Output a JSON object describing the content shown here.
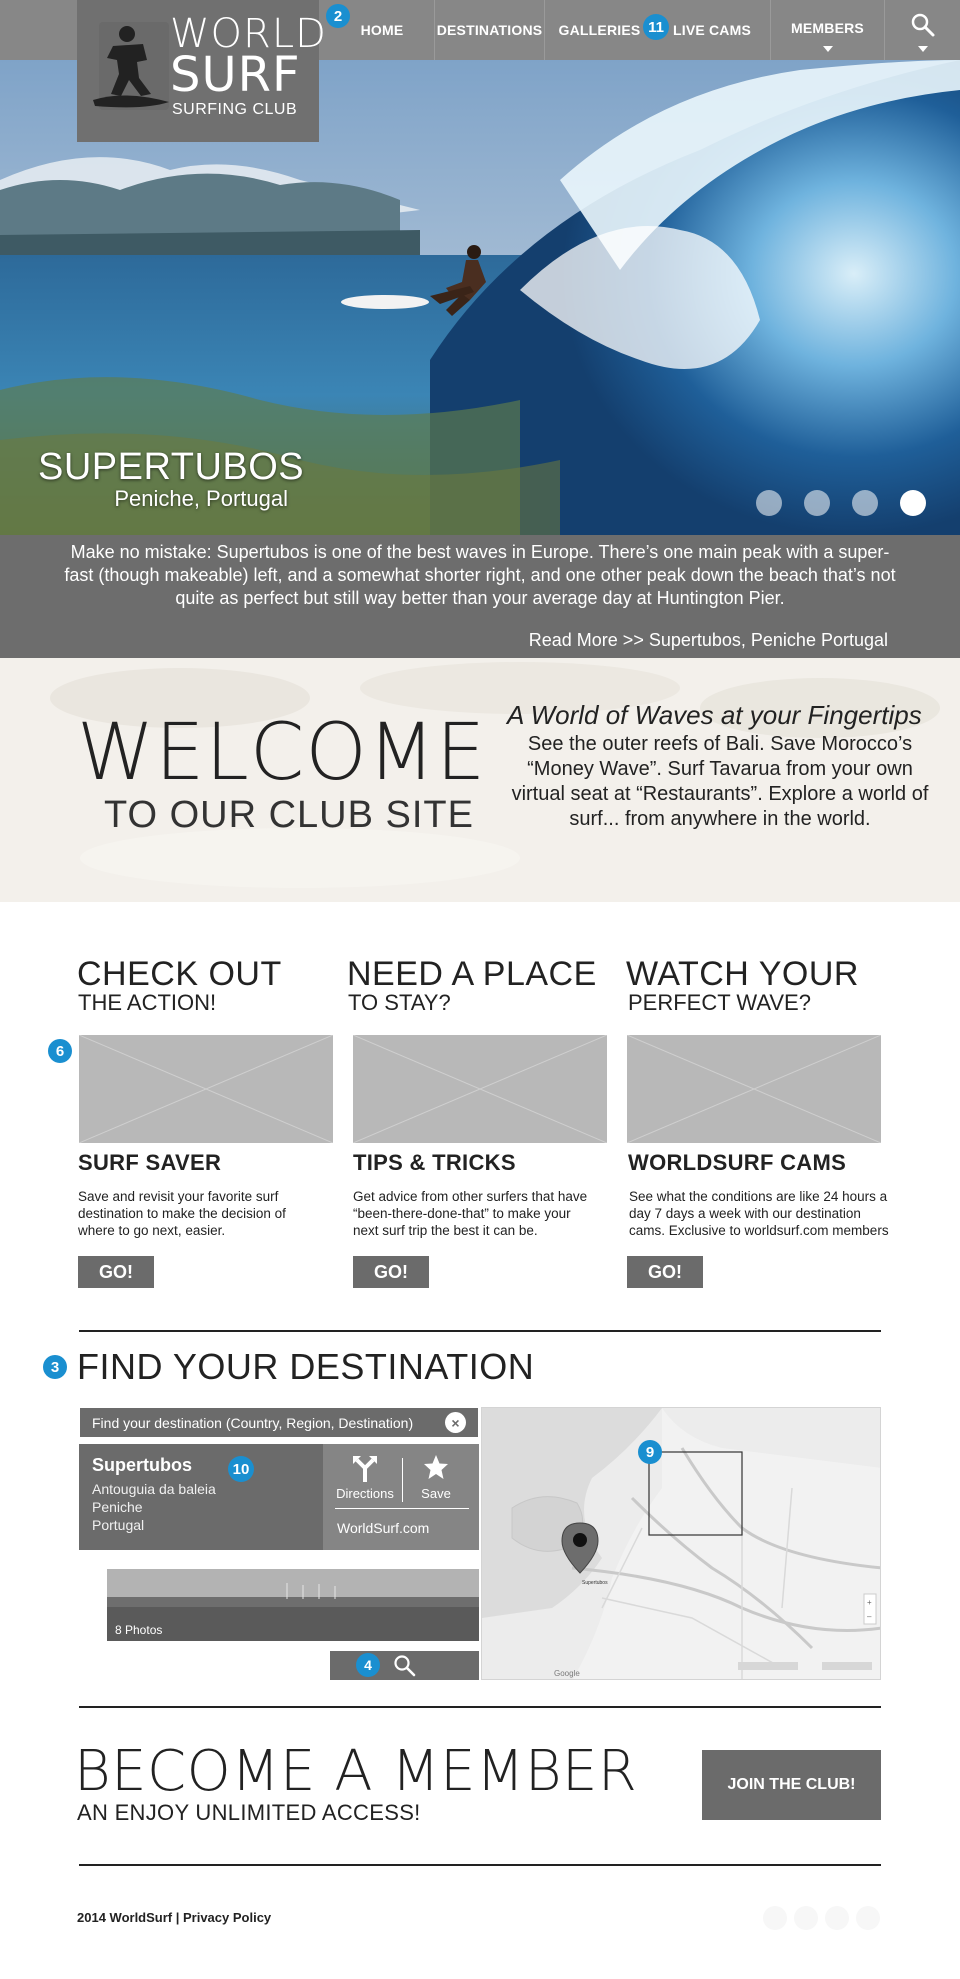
{
  "nav": {
    "items": [
      {
        "label": "HOME"
      },
      {
        "label": "DESTINATIONS"
      },
      {
        "label": "GALLERIES"
      },
      {
        "label": "LIVE CAMS"
      },
      {
        "label": "MEMBERS"
      }
    ]
  },
  "logo": {
    "line1": "WORLD",
    "line2": "SURF",
    "line3": "SURFING CLUB"
  },
  "badges": {
    "nav": "2",
    "livecams": "11",
    "features": "6",
    "find": "3",
    "search": "4",
    "map": "9",
    "result": "10"
  },
  "hero": {
    "title": "SUPERTUBOS",
    "subtitle": "Peniche, Portugal",
    "slides_total": 4,
    "active_slide": 4,
    "description": "Make no mistake: Supertubos is one of the best waves in Europe. There’s one main peak with a super-fast (though makeable) left, and a somewhat shorter right, and one other peak down the beach that’s not quite as perfect but still way better than your average day at Huntington Pier.",
    "read_more": "Read More >> Supertubos, Peniche Portugal"
  },
  "welcome": {
    "big": "WELCOME",
    "small": "TO OUR CLUB SITE",
    "tagline": "A World of  Waves at your Fingertips",
    "text": "See the outer reefs of Bali. Save Morocco’s “Money Wave”. Surf Tavarua from your own virtual seat at “Restaurants”. Explore a world of surf... from anywhere in the world."
  },
  "features": [
    {
      "heading": "CHECK OUT",
      "subheading": "THE ACTION!",
      "title": "SURF SAVER",
      "text": "Save and revisit your favorite surf destination to make the decision of where to go next, easier.",
      "button": "GO!"
    },
    {
      "heading": "NEED A PLACE",
      "subheading": "TO STAY?",
      "title": "TIPS & TRICKS",
      "text": "Get advice from other surfers that have “been-there-done-that” to make your next surf trip the best it can be.",
      "button": "GO!"
    },
    {
      "heading": "WATCH YOUR",
      "subheading": "PERFECT WAVE?",
      "title": "WORLDSURF CAMS",
      "text": "See what the conditions are like 24 hours a day 7 days a week with our destination cams. Exclusive to worldsurf.com members",
      "button": "GO!"
    }
  ],
  "find": {
    "title": "FIND YOUR DESTINATION",
    "placeholder": "Find your destination (Country, Region, Destination)",
    "result": {
      "name": "Supertubos",
      "lines": [
        "Antouguia da baleia",
        "Peniche",
        "Portugal"
      ],
      "directions": "Directions",
      "save": "Save",
      "site": "WorldSurf.com"
    },
    "photos": "8 Photos",
    "map": {
      "pin_label": "Supertubos",
      "provider": "Google"
    }
  },
  "member": {
    "big": "BECOME A MEMBER",
    "small": "AN ENJOY UNLIMITED ACCESS!",
    "button": "JOIN THE CLUB!"
  },
  "footer": {
    "text": "2014 WorldSurf | Privacy Policy"
  },
  "colors": {
    "nav": "#878787",
    "panel": "#6b6b6b",
    "badge": "#1a8fd0",
    "welcome_bg": "#f2efea"
  },
  "icons": [
    "search-icon",
    "caret-down-icon",
    "directions-icon",
    "star-icon",
    "close-icon",
    "map-pin-icon",
    "zoom-in-icon",
    "zoom-out-icon"
  ]
}
